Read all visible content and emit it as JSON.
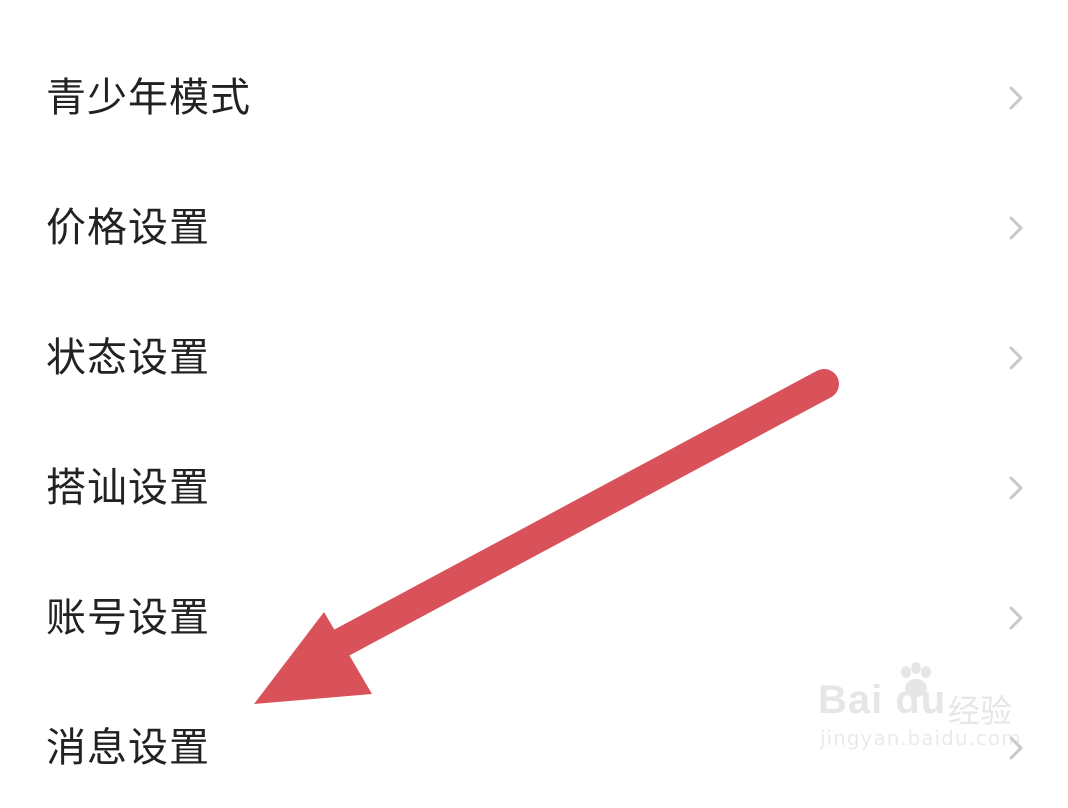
{
  "settings": {
    "items": [
      {
        "label": "青少年模式"
      },
      {
        "label": "价格设置"
      },
      {
        "label": "状态设置"
      },
      {
        "label": "搭讪设置"
      },
      {
        "label": "账号设置"
      },
      {
        "label": "消息设置"
      }
    ]
  },
  "annotation": {
    "arrow_color": "#d9525a",
    "arrow_points_to": "消息设置"
  },
  "watermark": {
    "brand": "Bai du",
    "text": "经验",
    "url": "jingyan.baidu.com"
  },
  "colors": {
    "text": "#222222",
    "chevron": "#c8c8c8",
    "background": "#ffffff"
  }
}
